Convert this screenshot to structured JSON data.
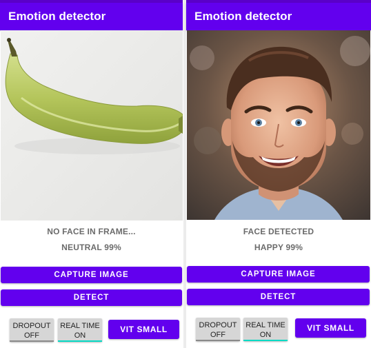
{
  "screens": [
    {
      "app_title": "Emotion detector",
      "preview_subject": "banana",
      "face_status": "NO FACE IN FRAME...",
      "emotion": "NEUTRAL 99%",
      "capture_label": "CAPTURE IMAGE",
      "detect_label": "DETECT",
      "dropout": {
        "line1": "DROPOUT",
        "line2": "OFF",
        "state": "off"
      },
      "realtime": {
        "line1": "REAL TIME",
        "line2": "ON",
        "state": "on"
      },
      "model_label": "VIT SMALL"
    },
    {
      "app_title": "Emotion detector",
      "preview_subject": "smiling man",
      "face_status": "FACE DETECTED",
      "emotion": "HAPPY 99%",
      "capture_label": "CAPTURE IMAGE",
      "detect_label": "DETECT",
      "dropout": {
        "line1": "DROPOUT",
        "line2": "OFF",
        "state": "off"
      },
      "realtime": {
        "line1": "REAL TIME",
        "line2": "ON",
        "state": "on"
      },
      "model_label": "VIT SMALL"
    }
  ],
  "colors": {
    "primary": "#6200ee",
    "status_bar": "#5a00c9",
    "toggle_on_indicator": "#03dac5",
    "toggle_off_indicator": "#8a8a8a",
    "label_text": "#6b6b6b"
  }
}
